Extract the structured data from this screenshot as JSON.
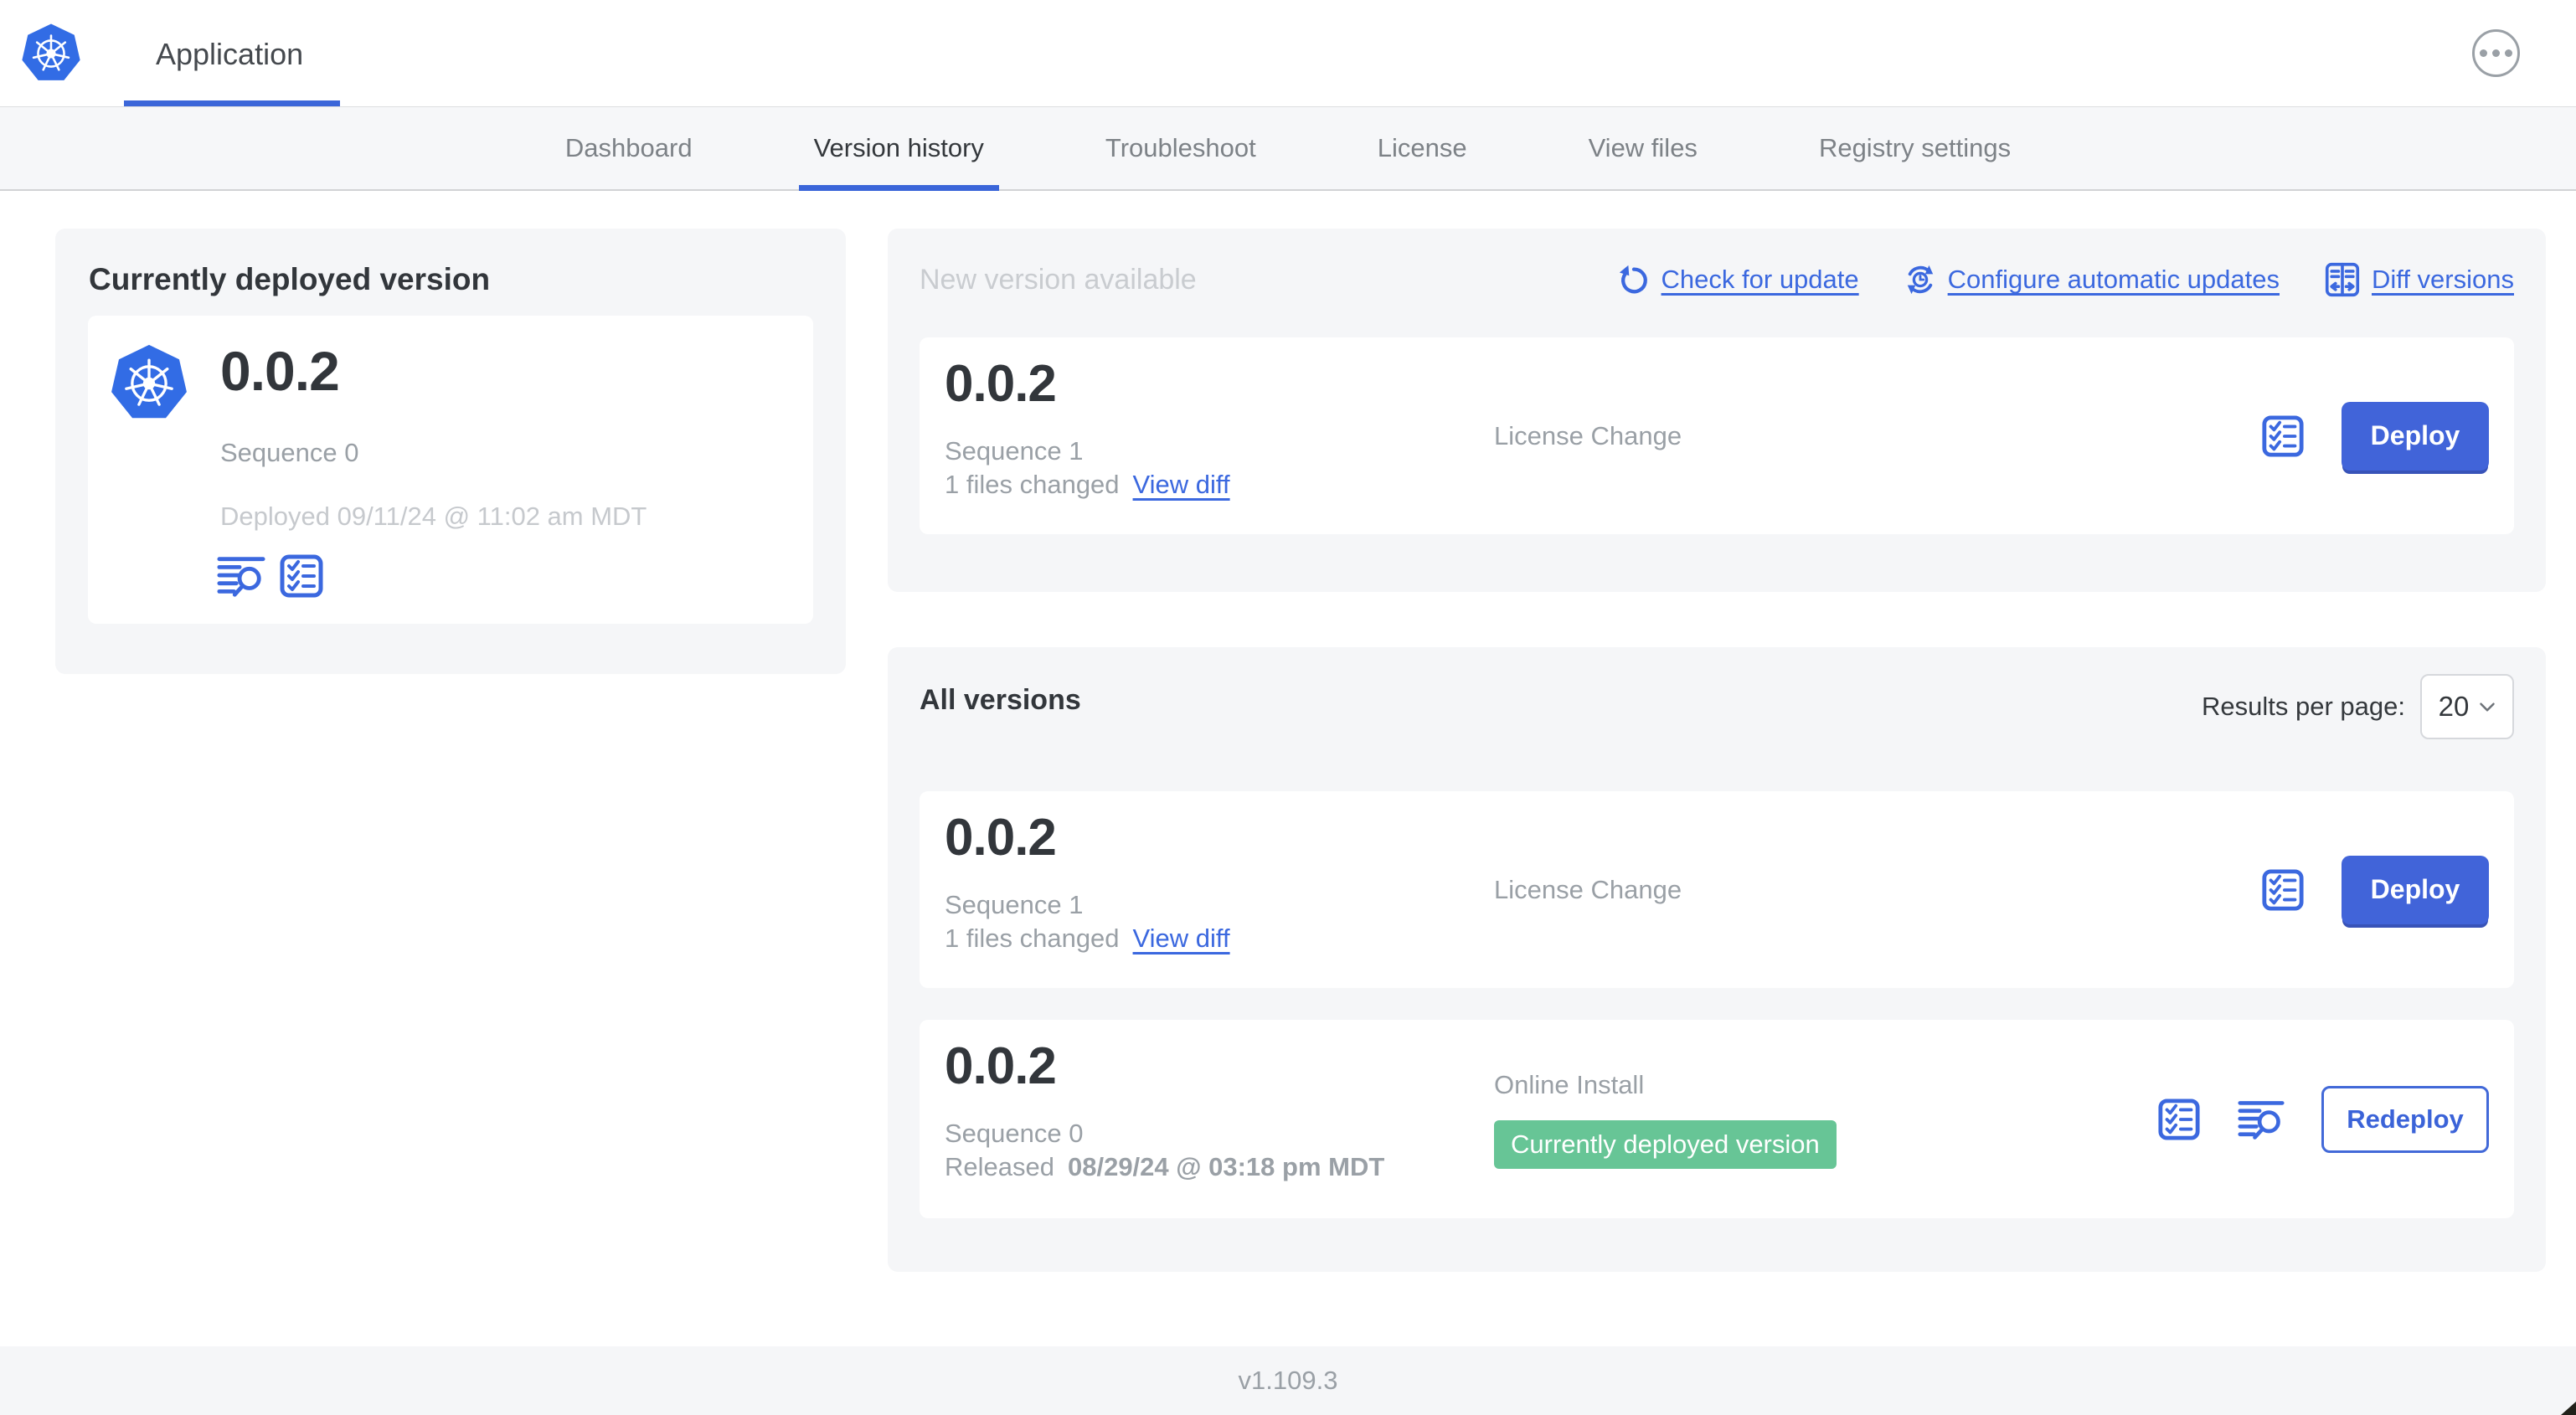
{
  "colors": {
    "accent_blue": "#3b68df",
    "button_blue": "#4164d9",
    "k8s_logo_blue": "#326ce5",
    "badge_green": "#67c596",
    "text_dark": "#32363b",
    "text_gray": "#9aa0a6",
    "text_light_gray": "#c6c9cd",
    "card_background": "#f5f6f8"
  },
  "header": {
    "title": "Application"
  },
  "nav": {
    "tabs": [
      "Dashboard",
      "Version history",
      "Troubleshoot",
      "License",
      "View files",
      "Registry settings"
    ],
    "active_tab": "Version history"
  },
  "current": {
    "title": "Currently deployed version",
    "version": "0.0.2",
    "sequence": "Sequence 0",
    "deployed": "Deployed 09/11/24 @ 11:02 am MDT"
  },
  "new_version": {
    "title": "New version available",
    "check_link": "Check for update",
    "configure_link": "Configure automatic updates",
    "diff_link": "Diff versions",
    "row": {
      "version": "0.0.2",
      "sequence": "Sequence 1",
      "files_changed": "1 files changed",
      "view_diff": "View diff",
      "source": "License Change",
      "action": "Deploy"
    }
  },
  "all_versions": {
    "title": "All versions",
    "results_label": "Results per page:",
    "results_value": "20",
    "rows": [
      {
        "version": "0.0.2",
        "sequence": "Sequence 1",
        "files_changed": "1 files changed",
        "view_diff": "View diff",
        "source": "License Change",
        "action": "Deploy"
      },
      {
        "version": "0.0.2",
        "sequence": "Sequence 0",
        "released_label": "Released",
        "released_date": "08/29/24 @ 03:18 pm MDT",
        "source": "Online Install",
        "badge": "Currently deployed version",
        "action": "Redeploy"
      }
    ]
  },
  "footer": {
    "app_version": "v1.109.3"
  },
  "icons": {
    "logo": "kubernetes-helm",
    "menu": "ellipsis-circle",
    "logs": "view-logs-magnifier",
    "checks": "preflight-checklist",
    "refresh": "check-update-refresh",
    "auto_update": "auto-update-clock-arrows",
    "diff": "diff-two-columns",
    "chevron": "chevron-down"
  }
}
